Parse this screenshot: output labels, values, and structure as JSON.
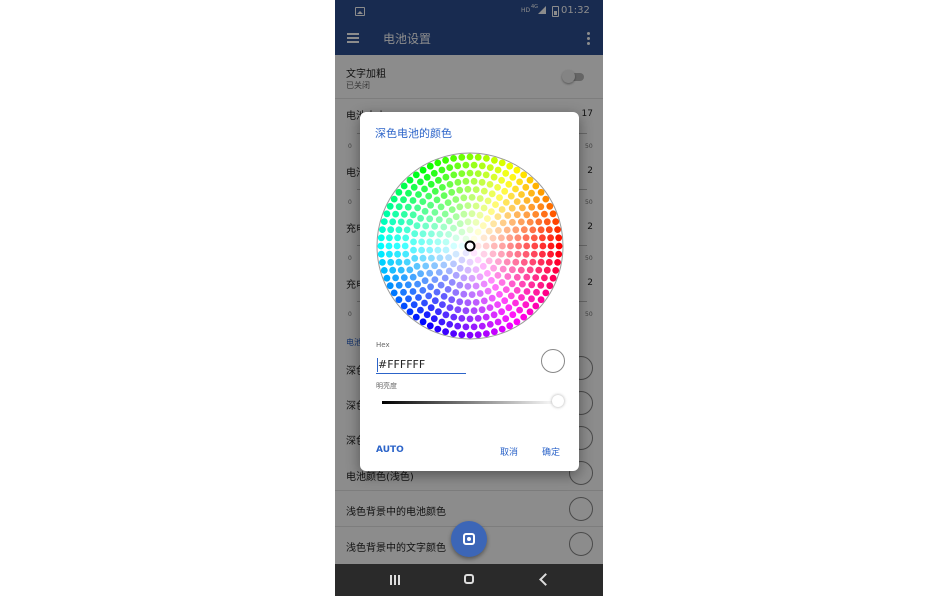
{
  "status_bar": {
    "hd_label": "HD",
    "network_label": "4G",
    "time": "01:32"
  },
  "app_bar": {
    "title": "电池设置"
  },
  "settings": {
    "bold_text": {
      "label": "文字加粗",
      "sub": "已关闭",
      "enabled": false
    },
    "rows": [
      {
        "label": "电池大小",
        "value": "17"
      },
      {
        "label": "电池",
        "value": "2"
      },
      {
        "label": "充电",
        "value": "2"
      },
      {
        "label": "充电",
        "value": "2"
      }
    ],
    "slider_min": "0",
    "slider_max": "50",
    "section_title": "电池",
    "color_rows": [
      {
        "label": "深色"
      },
      {
        "label": "深色"
      },
      {
        "label": "深色"
      },
      {
        "label": "电池颜色(浅色)"
      },
      {
        "label": "浅色背景中的电池颜色"
      },
      {
        "label": "浅色背景中的文字颜色"
      }
    ]
  },
  "dialog": {
    "title": "深色电池的颜色",
    "hex_label": "Hex",
    "hex_value": "#FFFFFF",
    "selected_color": "#ffffff",
    "brightness_label": "明亮度",
    "brightness": 1.0,
    "auto_button": "AUTO",
    "cancel_button": "取消",
    "ok_button": "确定"
  },
  "colors": {
    "primary": "#2c4f93",
    "accent": "#2c64c9",
    "fab": "#3c66b7"
  }
}
